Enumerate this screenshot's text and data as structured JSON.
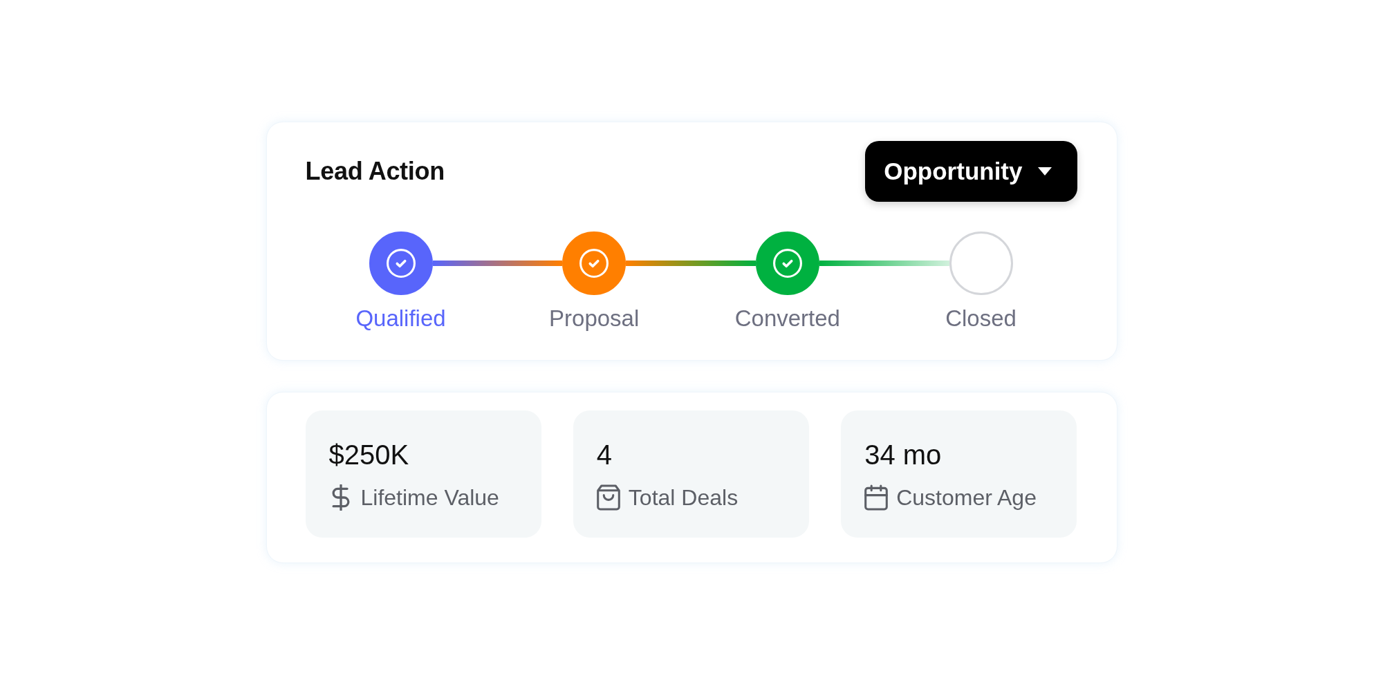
{
  "lead_card": {
    "title": "Lead Action",
    "stage_dropdown": {
      "value": "Opportunity"
    }
  },
  "steps": [
    {
      "label": "Qualified",
      "color": "#5865fb",
      "done": true,
      "selected": true
    },
    {
      "label": "Proposal",
      "color": "#ff7f00",
      "done": true,
      "selected": false
    },
    {
      "label": "Converted",
      "color": "#00b140",
      "done": true,
      "selected": false
    },
    {
      "label": "Closed",
      "color": "#d4d6da",
      "done": false,
      "selected": false
    }
  ],
  "stats": [
    {
      "kind": "dollar",
      "value": "$250K",
      "label": "Lifetime Value"
    },
    {
      "kind": "bag",
      "value": "4",
      "label": "Total Deals"
    },
    {
      "kind": "calendar",
      "value": "34 mo",
      "label": "Customer Age"
    }
  ]
}
